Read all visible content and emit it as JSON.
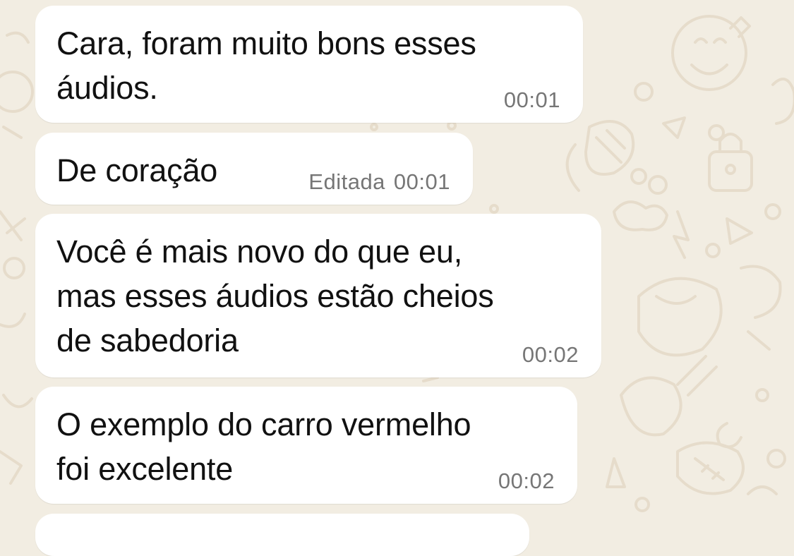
{
  "chat": {
    "messages": [
      {
        "text": "Cara, foram muito bons esses\náudios.",
        "time": "00:01",
        "edited": ""
      },
      {
        "text": "De coração",
        "time": "00:01",
        "edited": "Editada"
      },
      {
        "text": "Você é mais novo do que eu,\nmas esses áudios estão cheios\nde sabedoria",
        "time": "00:02",
        "edited": ""
      },
      {
        "text": "O exemplo do carro vermelho\nfoi excelente",
        "time": "00:02",
        "edited": ""
      }
    ]
  },
  "colors": {
    "wallpaper": "#f2ede2",
    "wallpaper_doodle": "#e6dccb",
    "bubble": "#ffffff",
    "message_text": "#111111",
    "timestamp": "#767676"
  }
}
